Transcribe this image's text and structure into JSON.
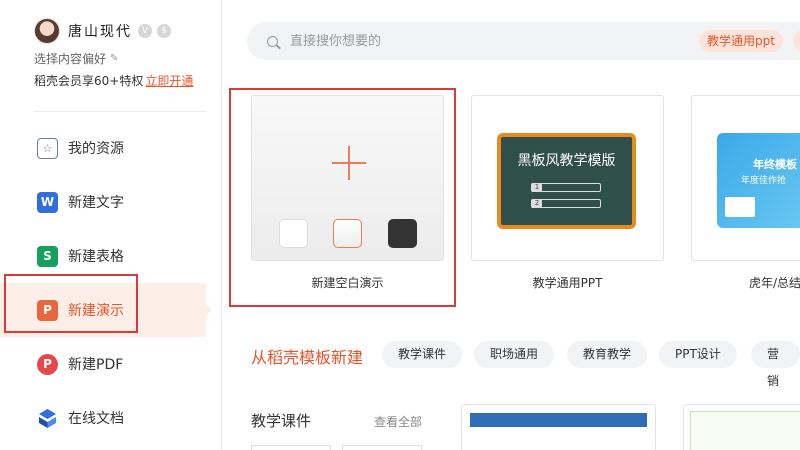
{
  "user": {
    "name": "唐山现代",
    "badges": [
      "V",
      "$"
    ],
    "preference_label": "选择内容偏好",
    "vip_text": "稻壳会员享60+特权",
    "vip_link": "立即开通"
  },
  "nav": {
    "items": [
      {
        "label": "我的资源",
        "icon": "resources-icon",
        "glyph": "☆"
      },
      {
        "label": "新建文字",
        "icon": "writer-icon",
        "glyph": "W"
      },
      {
        "label": "新建表格",
        "icon": "spreadsheet-icon",
        "glyph": "S"
      },
      {
        "label": "新建演示",
        "icon": "presentation-icon",
        "glyph": "P",
        "active": true
      },
      {
        "label": "新建PDF",
        "icon": "pdf-icon",
        "glyph": "P"
      },
      {
        "label": "在线文档",
        "icon": "online-doc-icon",
        "glyph": ""
      }
    ]
  },
  "search": {
    "placeholder": "直接搜你想要的",
    "tags": [
      "教学通用ppt",
      ""
    ]
  },
  "templates": {
    "blank": {
      "label": "新建空白演示"
    },
    "chalk": {
      "label": "教学通用PPT",
      "board_title": "黑板风教学模版",
      "lines": [
        "1",
        "2"
      ]
    },
    "tiger": {
      "label": "虎年/总结",
      "title": "年终模板",
      "subtitle": "年度佳作抢"
    }
  },
  "section": {
    "title": "从稻壳模板新建",
    "pills": [
      "教学课件",
      "职场通用",
      "教育教学",
      "PPT设计",
      "营销"
    ]
  },
  "subsection": {
    "title": "教学课件",
    "see_all": "查看全部"
  },
  "colors": {
    "accent": "#e8542b",
    "highlight_border": "#d93a3a",
    "active_bg": "#fdeee8"
  }
}
